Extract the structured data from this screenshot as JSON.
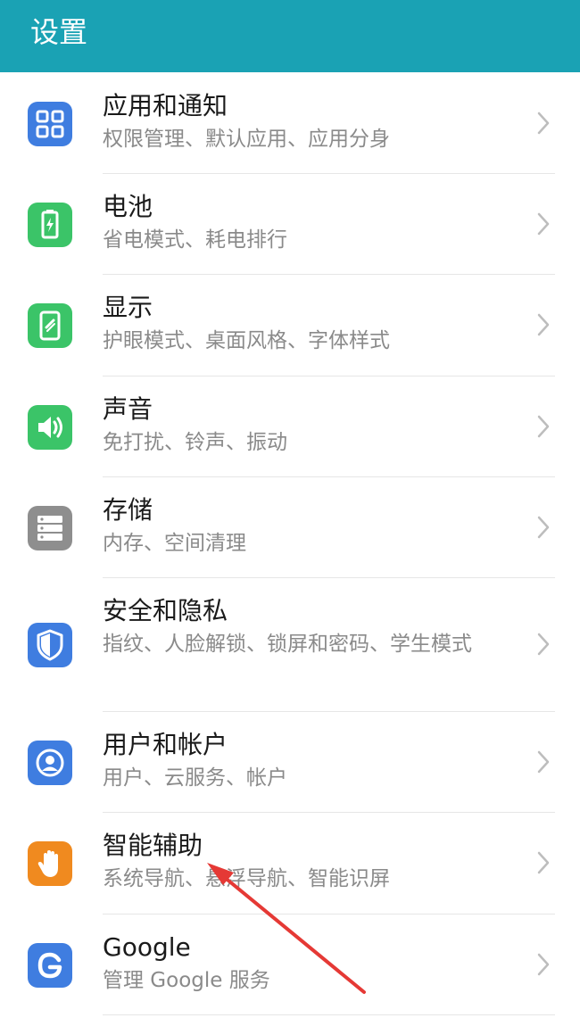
{
  "header": {
    "title": "设置"
  },
  "items": [
    {
      "title": "应用和通知",
      "subtitle": "权限管理、默认应用、应用分身",
      "icon": "apps-grid-icon",
      "color": "#3f7de0"
    },
    {
      "title": "电池",
      "subtitle": "省电模式、耗电排行",
      "icon": "battery-icon",
      "color": "#3bc468"
    },
    {
      "title": "显示",
      "subtitle": "护眼模式、桌面风格、字体样式",
      "icon": "display-icon",
      "color": "#3bc468"
    },
    {
      "title": "声音",
      "subtitle": "免打扰、铃声、振动",
      "icon": "sound-icon",
      "color": "#3bc468"
    },
    {
      "title": "存储",
      "subtitle": "内存、空间清理",
      "icon": "storage-icon",
      "color": "#8e8e8e"
    },
    {
      "title": "安全和隐私",
      "subtitle": "指纹、人脸解锁、锁屏和密码、学生模式",
      "icon": "shield-icon",
      "color": "#3f7de0"
    },
    {
      "title": "用户和帐户",
      "subtitle": "用户、云服务、帐户",
      "icon": "user-account-icon",
      "color": "#3f7de0"
    },
    {
      "title": "智能辅助",
      "subtitle": "系统导航、悬浮导航、智能识屏",
      "icon": "hand-icon",
      "color": "#f08a1f"
    },
    {
      "title": "Google",
      "subtitle": "管理 Google 服务",
      "icon": "google-icon",
      "color": "#3f7de0"
    }
  ],
  "colors": {
    "header_bg": "#1aa2b4",
    "annotation_arrow": "#e53935"
  }
}
